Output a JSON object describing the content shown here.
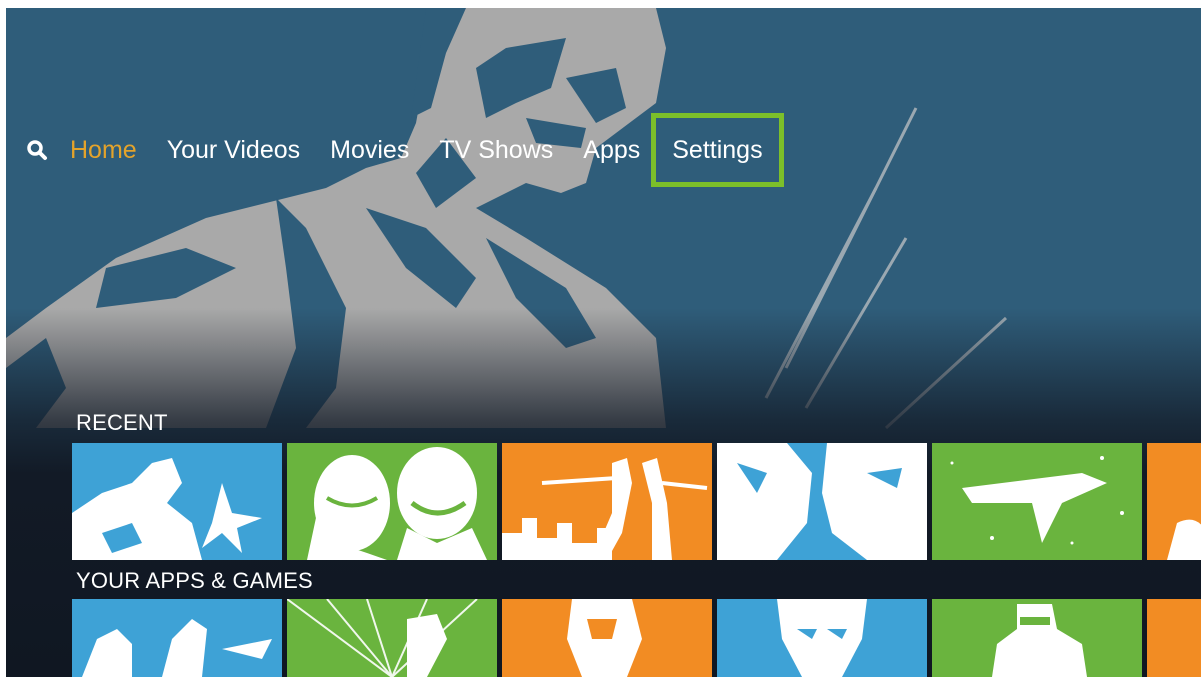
{
  "colors": {
    "background": "#2f5d7a",
    "figure": "#a9a9a9",
    "active_nav": "#e3a32b",
    "focus_outline": "#7cbf2a",
    "tile_blue": "#3ea2d6",
    "tile_green": "#6ab43e",
    "tile_orange": "#f28c23"
  },
  "nav": {
    "search_icon": "search-icon",
    "items": [
      {
        "label": "Home",
        "active": true
      },
      {
        "label": "Your Videos"
      },
      {
        "label": "Movies"
      },
      {
        "label": "TV Shows"
      },
      {
        "label": "Apps"
      },
      {
        "label": "Settings",
        "focused": true
      }
    ]
  },
  "rows": {
    "recent": {
      "title": "RECENT",
      "tiles": [
        "blue",
        "green",
        "orange",
        "blue",
        "green",
        "orange"
      ]
    },
    "apps": {
      "title": "YOUR APPS & GAMES",
      "tiles": [
        "blue",
        "green",
        "orange",
        "blue",
        "green",
        "orange"
      ]
    }
  }
}
